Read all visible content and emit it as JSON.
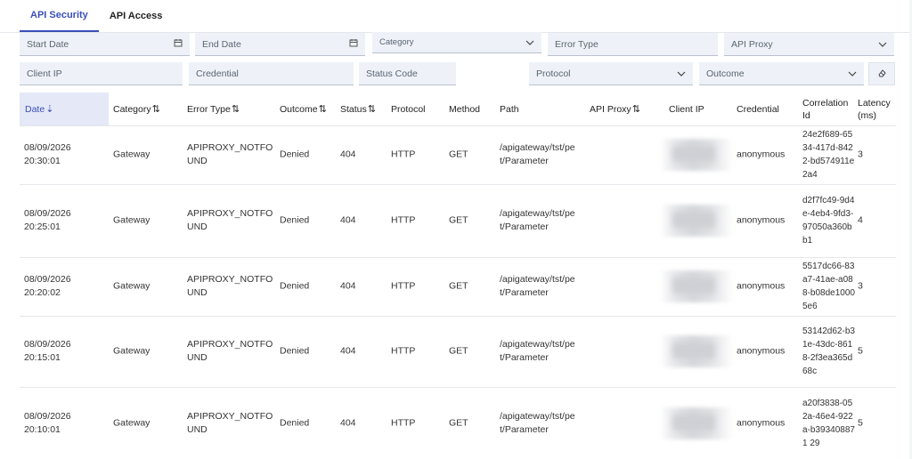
{
  "tabs": [
    {
      "label": "API Security",
      "active": true
    },
    {
      "label": "API Access",
      "active": false
    }
  ],
  "filters": {
    "start_date": "Start Date",
    "end_date": "End Date",
    "category": "Category",
    "error_type": "Error Type",
    "api_proxy": "API Proxy",
    "client_ip": "Client IP",
    "credential": "Credential",
    "status_code": "Status Code",
    "protocol": "Protocol",
    "outcome": "Outcome"
  },
  "table": {
    "columns": {
      "date": "Date",
      "category": "Category",
      "error_type": "Error Type",
      "outcome": "Outcome",
      "status": "Status",
      "protocol": "Protocol",
      "method": "Method",
      "path": "Path",
      "api_proxy": "API Proxy",
      "client_ip": "Client IP",
      "credential": "Credential",
      "correlation_id": "Correlation Id",
      "latency": "Latency (ms)"
    },
    "rows": [
      {
        "date": "08/09/2026\n20:30:01",
        "category": "Gateway",
        "error_type": "APIPROXY_NOTFO\nUND",
        "outcome": "Denied",
        "status": "404",
        "protocol": "HTTP",
        "method": "GET",
        "path": "/apigateway/tst/pe\nt/Parameter",
        "api_proxy": "",
        "credential": "anonymous",
        "correlation_id": "24e2f689-6534-417d-8422-bd574911e2a4",
        "latency": "3"
      },
      {
        "date": "08/09/2026\n20:25:01",
        "category": "Gateway",
        "error_type": "APIPROXY_NOTFO\nUND",
        "outcome": "Denied",
        "status": "404",
        "protocol": "HTTP",
        "method": "GET",
        "path": "/apigateway/tst/pe\nt/Parameter",
        "api_proxy": "",
        "credential": "anonymous",
        "correlation_id": "d2f7fc49-9d4e-4eb4-9fd3-97050a360bb1",
        "latency": "4"
      },
      {
        "date": "08/09/2026\n20:20:02",
        "category": "Gateway",
        "error_type": "APIPROXY_NOTFO\nUND",
        "outcome": "Denied",
        "status": "404",
        "protocol": "HTTP",
        "method": "GET",
        "path": "/apigateway/tst/pe\nt/Parameter",
        "api_proxy": "",
        "credential": "anonymous",
        "correlation_id": "5517dc66-83a7-41ae-a088-b08de10005e6",
        "latency": "3"
      },
      {
        "date": "08/09/2026\n20:15:01",
        "category": "Gateway",
        "error_type": "APIPROXY_NOTFO\nUND",
        "outcome": "Denied",
        "status": "404",
        "protocol": "HTTP",
        "method": "GET",
        "path": "/apigateway/tst/pe\nt/Parameter",
        "api_proxy": "",
        "credential": "anonymous",
        "correlation_id": "53142d62-b31e-43dc-8618-2f3ea365d68c",
        "latency": "5"
      },
      {
        "date": "08/09/2026\n20:10:01",
        "category": "Gateway",
        "error_type": "APIPROXY_NOTFO\nUND",
        "outcome": "Denied",
        "status": "404",
        "protocol": "HTTP",
        "method": "GET",
        "path": "/apigateway/tst/pe\nt/Parameter",
        "api_proxy": "",
        "credential": "anonymous",
        "correlation_id": "a20f3838-052a-46e4-922a-b393408871 29",
        "latency": "5"
      }
    ]
  },
  "icons": {
    "calendar": "calendar-icon",
    "chevron": "chevron-down-icon",
    "clear": "eraser-icon",
    "sort": "sort-icon"
  },
  "colors": {
    "accent": "#3b4fb8",
    "field_bg": "#eef2f8",
    "sorted_header_bg": "#e5e8f7"
  }
}
